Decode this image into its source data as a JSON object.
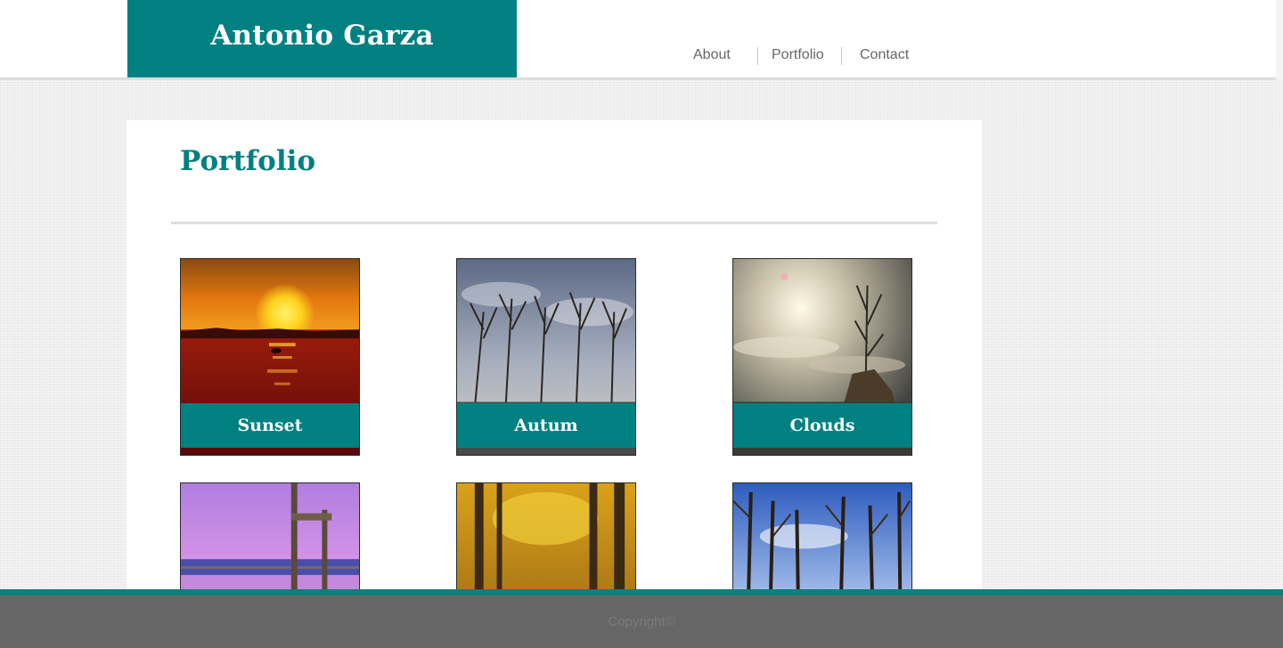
{
  "header": {
    "brand_name": "Antonio Garza",
    "nav": [
      {
        "label": "About"
      },
      {
        "label": "Portfolio"
      },
      {
        "label": "Contact"
      }
    ]
  },
  "main": {
    "title": "Portfolio",
    "items": [
      {
        "caption": "Sunset"
      },
      {
        "caption": "Autum"
      },
      {
        "caption": "Clouds"
      },
      {
        "caption": ""
      },
      {
        "caption": ""
      },
      {
        "caption": ""
      }
    ]
  },
  "footer": {
    "copyright": "Copyright©"
  },
  "colors": {
    "brand_teal": "#008080",
    "footer_gray": "#666666",
    "page_background": "#efefef"
  }
}
